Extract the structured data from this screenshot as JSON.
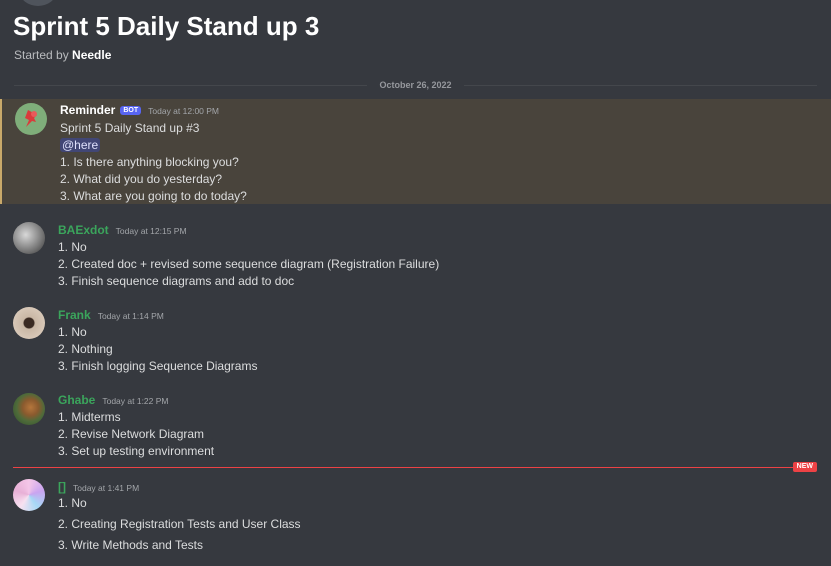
{
  "thread": {
    "title": "Sprint 5 Daily Stand up 3",
    "started_by_label": "Started by",
    "started_by_name": "Needle",
    "date": "October 26, 2022"
  },
  "colors": {
    "background": "#36393f",
    "highlight": "#49443c",
    "highlight_border": "#c9a96a",
    "user_name": "#3ba55c",
    "new_divider": "#ed4245",
    "bot_tag": "#5865f2"
  },
  "messages": [
    {
      "name": "Reminder",
      "bot_tag": "BOT",
      "time": "Today at 12:00 PM",
      "avatar_icon": "pushpin-icon",
      "lines": [
        "Sprint 5 Daily Stand up #3",
        "@here",
        "1. Is there anything blocking you?",
        "2. What did you do yesterday?",
        "3. What are you going to do today?"
      ]
    },
    {
      "name": "BAExdot",
      "time": "Today at 12:15 PM",
      "lines": [
        "1. No",
        "2. Created doc + revised some sequence diagram (Registration Failure)",
        "3. Finish sequence diagrams and add to doc"
      ]
    },
    {
      "name": "Frank",
      "time": "Today at 1:14 PM",
      "lines": [
        "1. No",
        "2. Nothing",
        "3. Finish logging Sequence Diagrams"
      ]
    },
    {
      "name": "Ghabe",
      "time": "Today at 1:22 PM",
      "lines": [
        "1. Midterms",
        "2. Revise Network Diagram",
        "3. Set up testing environment"
      ]
    },
    {
      "name": "[]",
      "time": "Today at 1:41 PM",
      "lines": [
        "1. No",
        "2. Creating Registration Tests and User Class",
        "3. Write Methods and Tests"
      ]
    }
  ],
  "new_badge": "NEW"
}
